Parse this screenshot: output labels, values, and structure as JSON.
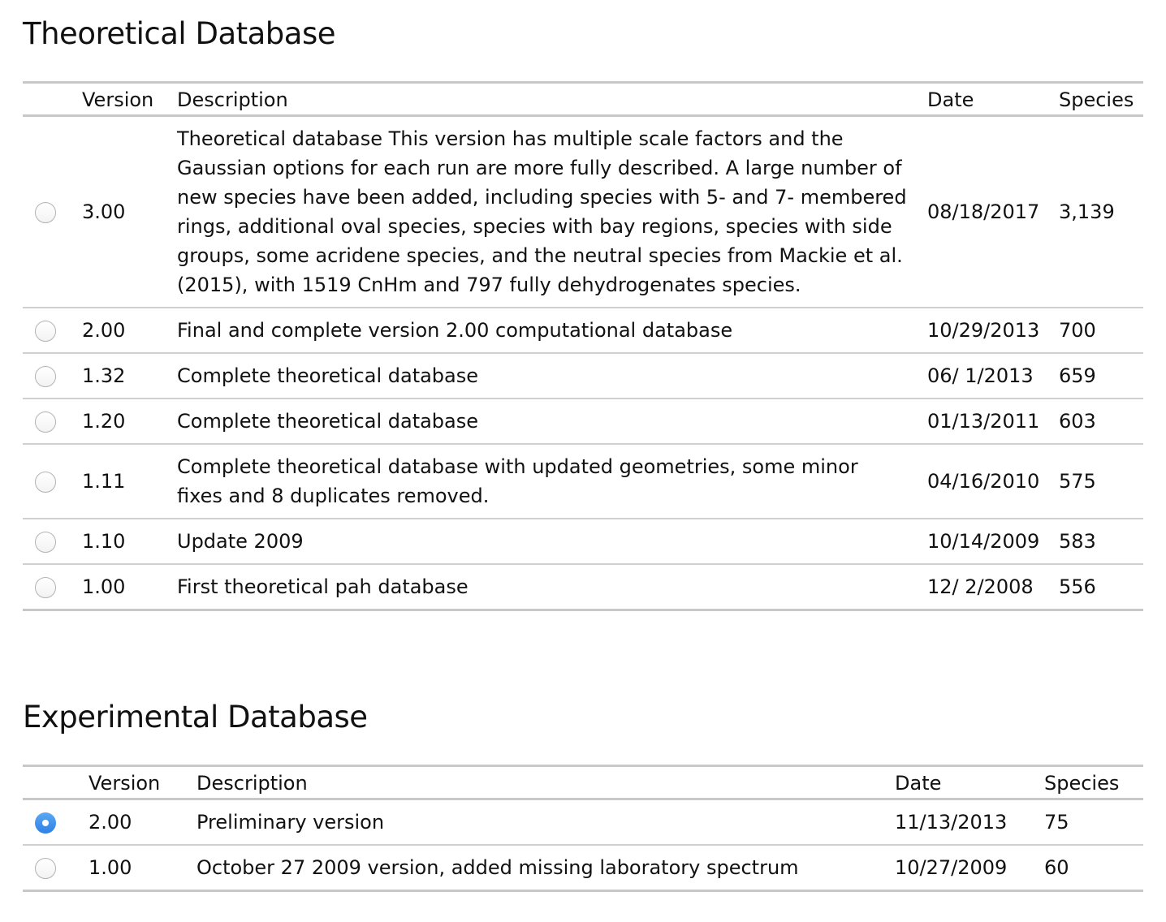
{
  "theoretical": {
    "title": "Theoretical Database",
    "headers": {
      "version": "Version",
      "description": "Description",
      "date": "Date",
      "species": "Species"
    },
    "rows": [
      {
        "selected": false,
        "version": "3.00",
        "description": "Theoretical database This version has multiple scale factors and the Gaussian options for each run are more fully described. A large number of new species have been added, including species with 5- and 7- membered rings, additional oval species, species with bay regions, species with side groups, some acridene species, and the neutral species from Mackie et al. (2015), with 1519 CnHm and 797 fully dehydrogenates species.",
        "date": "08/18/2017",
        "species": "3,139"
      },
      {
        "selected": false,
        "version": "2.00",
        "description": "Final and complete version 2.00 computational database",
        "date": "10/29/2013",
        "species": "700"
      },
      {
        "selected": false,
        "version": "1.32",
        "description": "Complete theoretical database",
        "date": "06/ 1/2013",
        "species": "659"
      },
      {
        "selected": false,
        "version": "1.20",
        "description": "Complete theoretical database",
        "date": "01/13/2011",
        "species": "603"
      },
      {
        "selected": false,
        "version": "1.11",
        "description": "Complete theoretical database with updated geometries, some minor fixes and 8 duplicates removed.",
        "date": "04/16/2010",
        "species": "575"
      },
      {
        "selected": false,
        "version": "1.10",
        "description": "Update 2009",
        "date": "10/14/2009",
        "species": "583"
      },
      {
        "selected": false,
        "version": "1.00",
        "description": "First theoretical pah database",
        "date": "12/ 2/2008",
        "species": "556"
      }
    ]
  },
  "experimental": {
    "title": "Experimental Database",
    "headers": {
      "version": "Version",
      "description": "Description",
      "date": "Date",
      "species": "Species"
    },
    "rows": [
      {
        "selected": true,
        "version": "2.00",
        "description": "Preliminary version",
        "date": "11/13/2013",
        "species": "75"
      },
      {
        "selected": false,
        "version": "1.00",
        "description": "October 27 2009 version, added missing laboratory spectrum",
        "date": "10/27/2009",
        "species": "60"
      }
    ]
  },
  "colors": {
    "radio_selected": "#2f80e6",
    "rule": "#c8c8c8",
    "text": "#111111"
  }
}
